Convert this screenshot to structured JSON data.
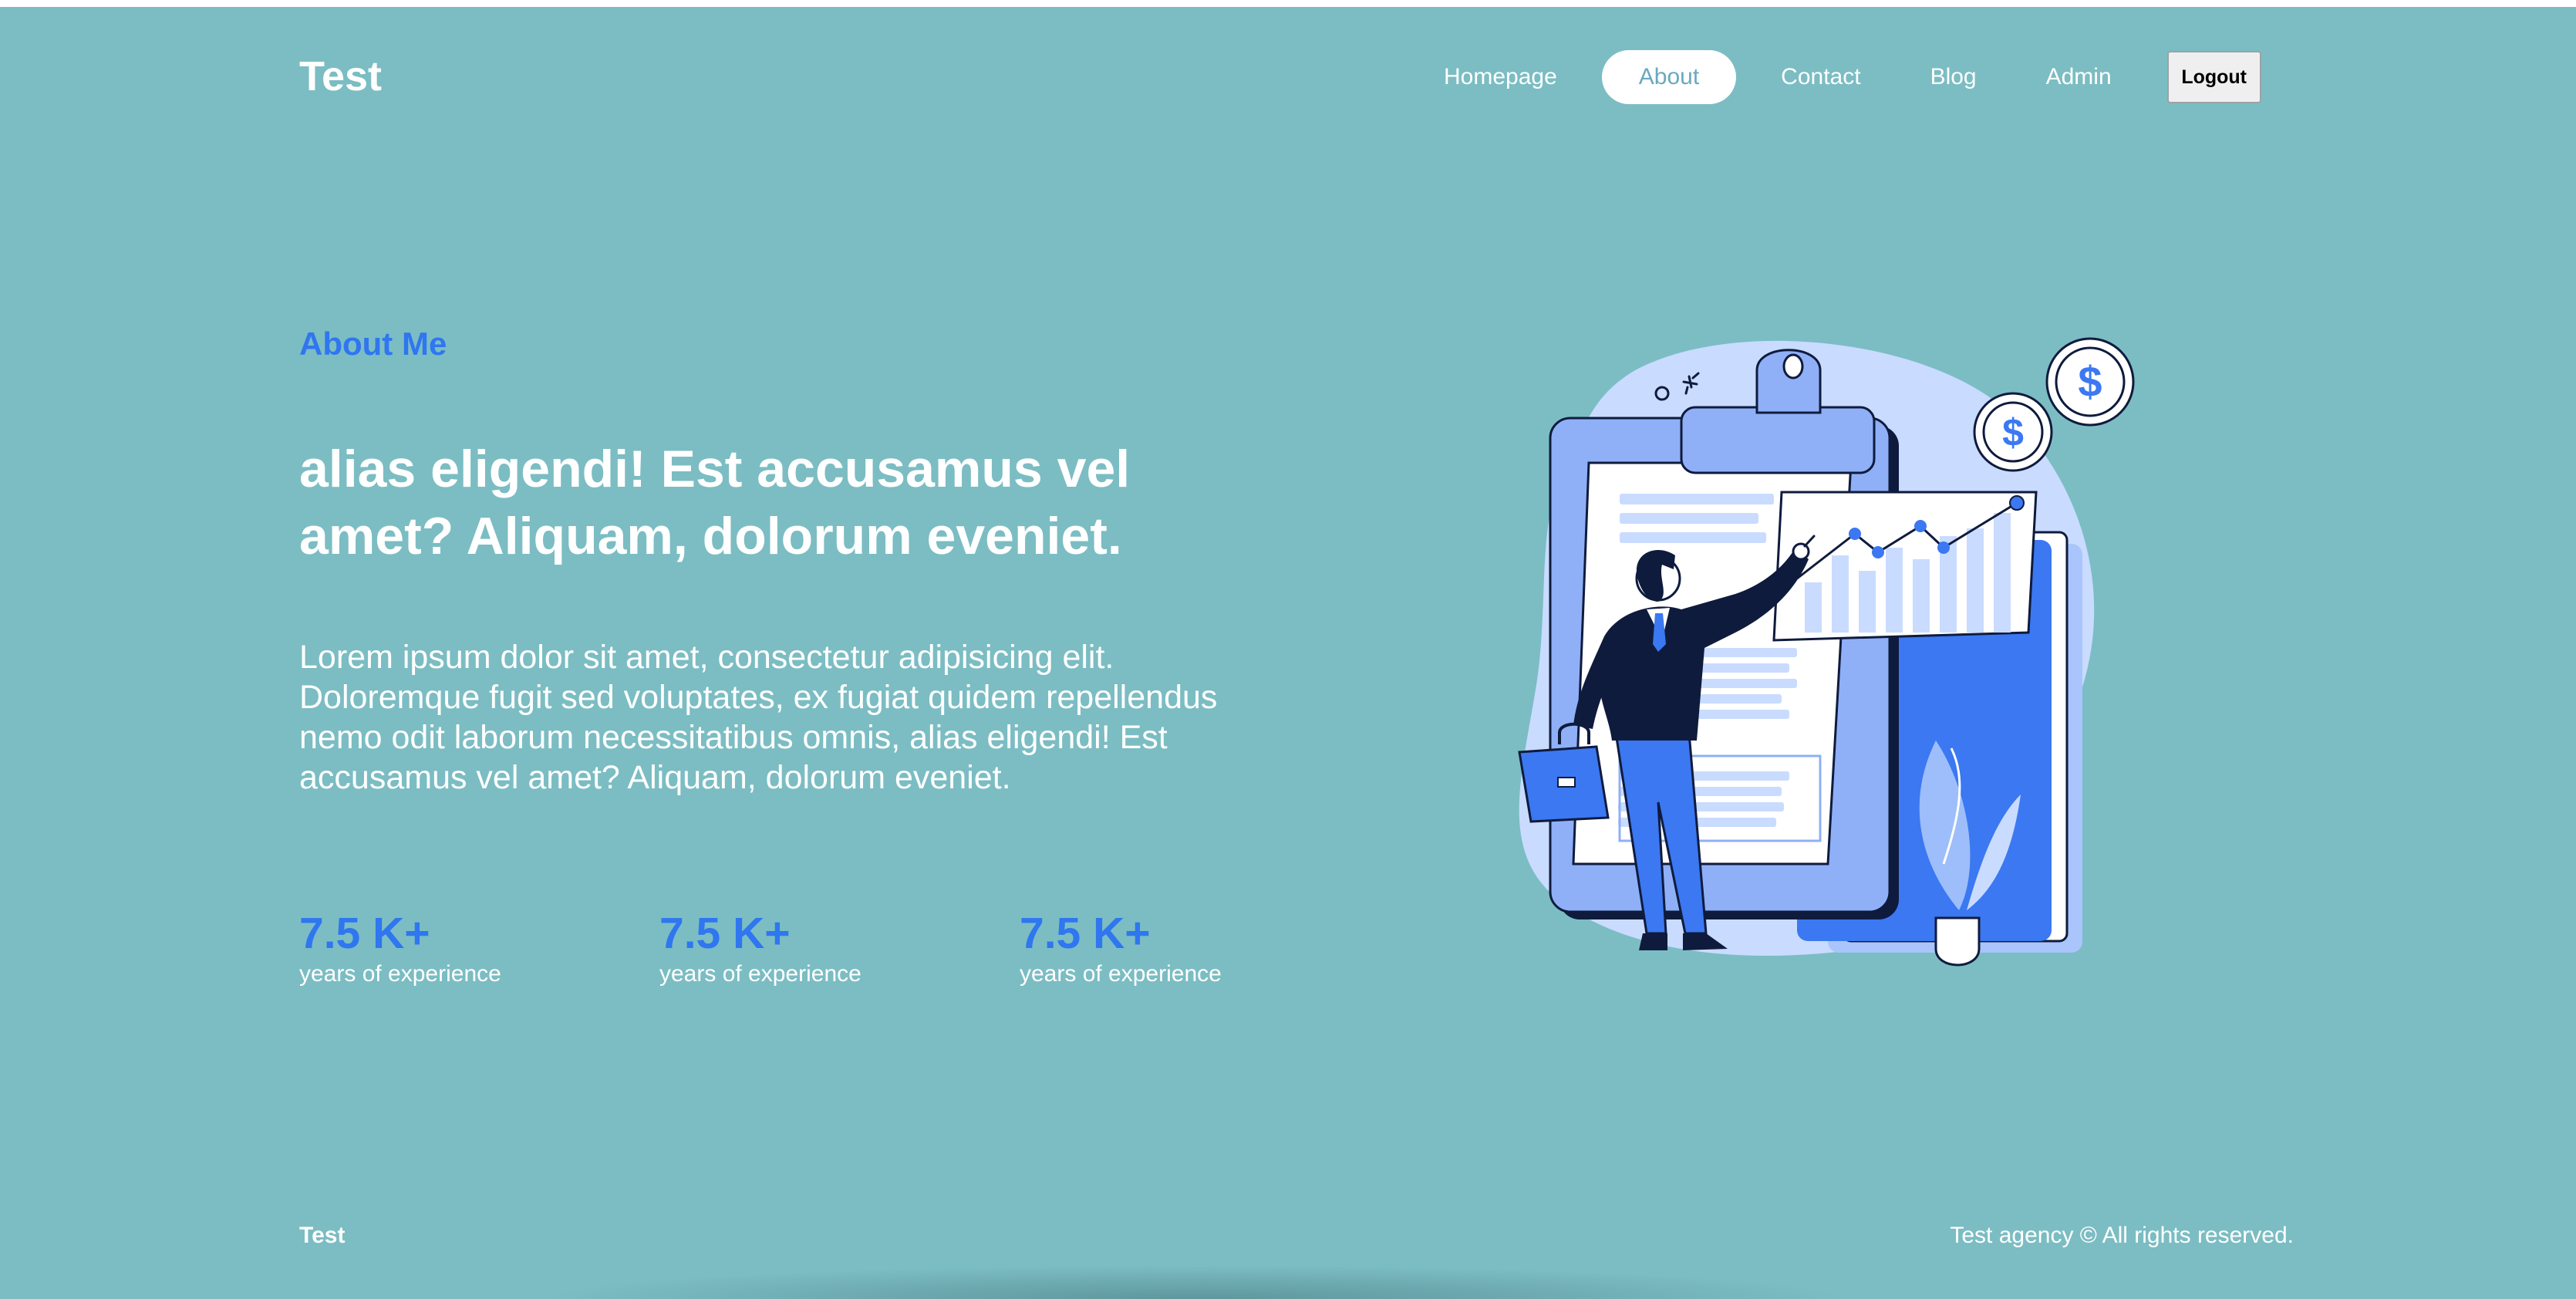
{
  "brand": "Test",
  "nav": {
    "items": [
      "Homepage",
      "About",
      "Contact",
      "Blog",
      "Admin"
    ],
    "active": "About",
    "logout": "Logout"
  },
  "hero": {
    "eyebrow": "About Me",
    "headline": "alias eligendi! Est accusamus vel amet? Aliquam, dolorum eveniet.",
    "body": "Lorem ipsum dolor sit amet, consectetur adipisicing elit. Doloremque fugit sed voluptates, ex fugiat quidem repellendus nemo odit laborum necessitatibus omnis, alias eligendi! Est accusamus vel amet? Aliquam, dolorum eveniet.",
    "stats": [
      {
        "value": "7.5 K+",
        "label": "years of experience"
      },
      {
        "value": "7.5 K+",
        "label": "years of experience"
      },
      {
        "value": "7.5 K+",
        "label": "years of experience"
      }
    ],
    "illustration": {
      "icon": "businessman-presenting-chart-illustration",
      "coin_symbol": "$"
    }
  },
  "footer": {
    "brand": "Test",
    "copyright": "Test agency © All rights reserved."
  },
  "colors": {
    "background": "#7bbdc3",
    "accent": "#2f76f0",
    "illustration_blue": "#3b78f2",
    "illustration_light": "#c9dbff"
  }
}
